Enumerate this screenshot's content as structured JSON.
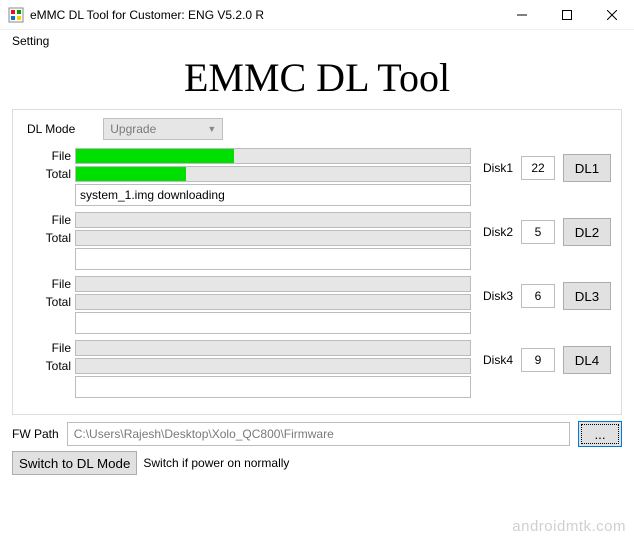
{
  "window": {
    "title": "eMMC DL Tool for Customer: ENG V5.2.0 R"
  },
  "menu": {
    "setting": "Setting"
  },
  "heading": "EMMC DL Tool",
  "dl_mode": {
    "label": "DL Mode",
    "value": "Upgrade"
  },
  "slots": [
    {
      "file_label": "File",
      "total_label": "Total",
      "file_pct": 40,
      "total_pct": 28,
      "status": "system_1.img downloading",
      "disk_label": "Disk1",
      "disk_val": "22",
      "btn": "DL1"
    },
    {
      "file_label": "File",
      "total_label": "Total",
      "file_pct": 0,
      "total_pct": 0,
      "status": "",
      "disk_label": "Disk2",
      "disk_val": "5",
      "btn": "DL2"
    },
    {
      "file_label": "File",
      "total_label": "Total",
      "file_pct": 0,
      "total_pct": 0,
      "status": "",
      "disk_label": "Disk3",
      "disk_val": "6",
      "btn": "DL3"
    },
    {
      "file_label": "File",
      "total_label": "Total",
      "file_pct": 0,
      "total_pct": 0,
      "status": "",
      "disk_label": "Disk4",
      "disk_val": "9",
      "btn": "DL4"
    }
  ],
  "fw": {
    "label": "FW Path",
    "path": "C:\\Users\\Rajesh\\Desktop\\Xolo_QC800\\Firmware",
    "browse": "..."
  },
  "bottom": {
    "switch_btn": "Switch to DL Mode",
    "hint": "Switch if power on normally"
  },
  "watermark": "androidmtk.com"
}
